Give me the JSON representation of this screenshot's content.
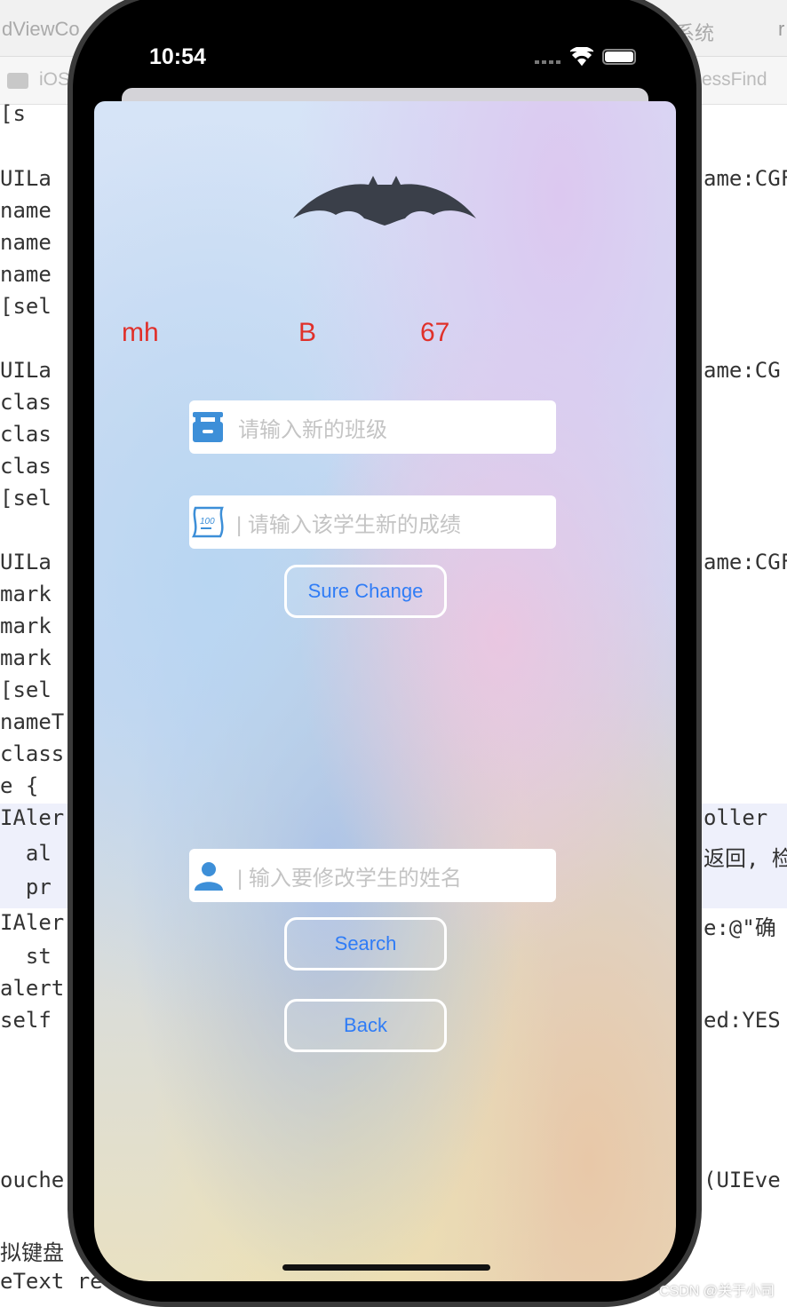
{
  "xcode": {
    "tabs": [
      "dViewCo",
      "系统",
      "r"
    ],
    "path": [
      "iOS",
      "essFind"
    ],
    "left_code": [
      [
        "[s",
        130
      ],
      [
        "UILa",
        203
      ],
      [
        "name",
        239
      ],
      [
        "name",
        275
      ],
      [
        "name",
        311
      ],
      [
        "[sel",
        347
      ],
      [
        "UILa",
        419
      ],
      [
        "clas",
        455
      ],
      [
        "clas",
        491
      ],
      [
        "clas",
        527
      ],
      [
        "[sel",
        563
      ],
      [
        "UILa",
        635
      ],
      [
        "mark",
        671
      ],
      [
        "mark",
        707
      ],
      [
        "mark",
        743
      ],
      [
        "[sel",
        779
      ],
      [
        "nameT",
        815
      ],
      [
        "class",
        851
      ],
      [
        "e {",
        887
      ],
      [
        "IAler",
        923
      ],
      [
        "  al",
        963
      ],
      [
        "  pr",
        1001
      ],
      [
        "IAler",
        1041
      ],
      [
        "  st",
        1079
      ],
      [
        "alert",
        1115
      ],
      [
        "self",
        1151
      ],
      [
        "ouche",
        1331
      ],
      [
        "拟键盘",
        1407
      ],
      [
        "eText re",
        1445
      ]
    ],
    "right_code": [
      [
        "ame:CGF",
        203
      ],
      [
        "ame:CG",
        419
      ],
      [
        "ame:CGF",
        635
      ],
      [
        "oller",
        923
      ],
      [
        "返回, 检查",
        963
      ],
      [
        "e:@\"确",
        1041
      ],
      [
        "ed:YES",
        1151
      ],
      [
        "(UIEve",
        1331
      ]
    ]
  },
  "status": {
    "time": "10:54"
  },
  "student": {
    "name": "mh",
    "class": "B",
    "score": "67"
  },
  "form": {
    "class_placeholder": "请输入新的班级",
    "score_placeholder": "| 请输入该学生新的成绩",
    "sure_change": "Sure Change",
    "name_placeholder": "| 输入要修改学生的姓名",
    "search": "Search",
    "back": "Back"
  },
  "watermark": "CSDN @关于小司",
  "colors": {
    "accent": "#2f7cf6",
    "label": "#e0302a",
    "icon": "#3d8fd8"
  }
}
